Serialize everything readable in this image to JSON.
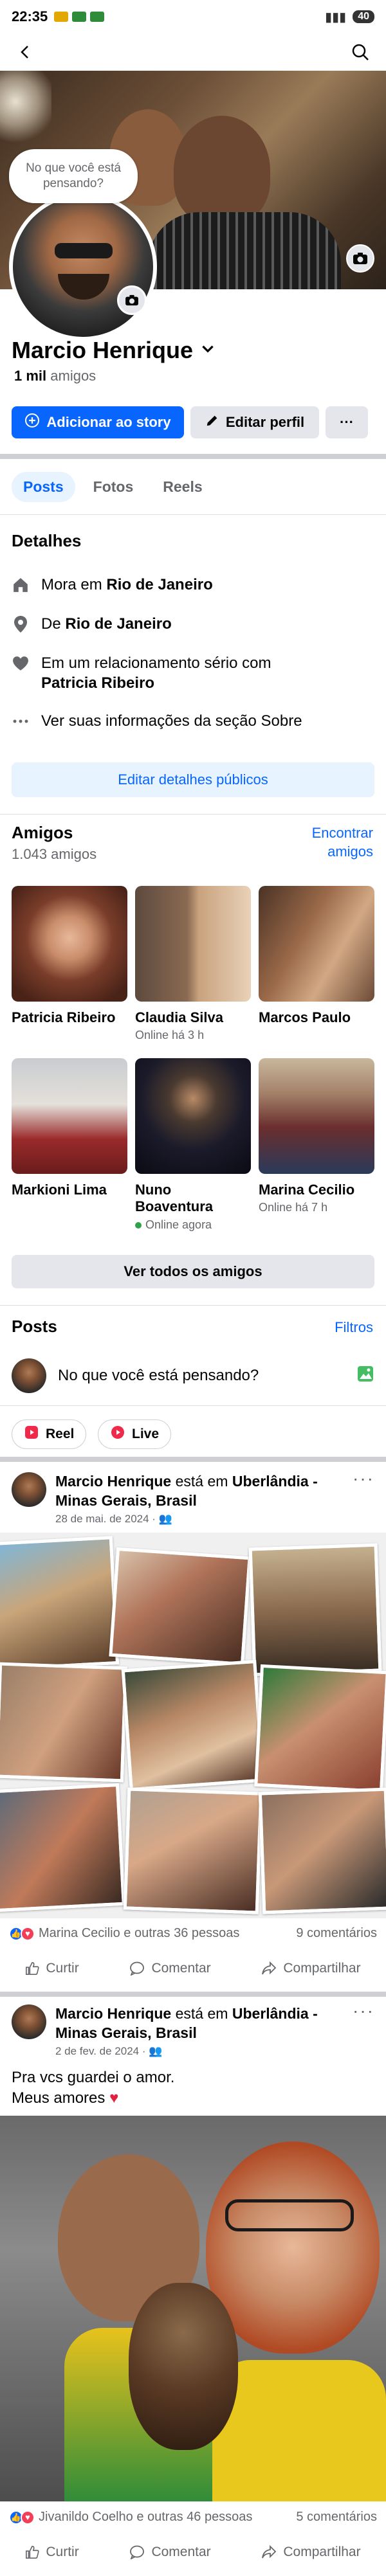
{
  "status_bar": {
    "time": "22:35",
    "battery": "40"
  },
  "cover": {
    "bubble_text": "No que você está pensando?"
  },
  "profile": {
    "name": "Marcio Henrique",
    "friends_count_bold": "1 mil",
    "friends_count_label": " amigos"
  },
  "actions": {
    "add_story": "Adicionar ao story",
    "edit_profile": "Editar perfil",
    "more": "···"
  },
  "tabs": [
    "Posts",
    "Fotos",
    "Reels"
  ],
  "details": {
    "title": "Detalhes",
    "lives_prefix": "Mora em ",
    "lives_city": "Rio de Janeiro",
    "from_prefix": "De ",
    "from_city": "Rio de Janeiro",
    "relationship_prefix": "Em um relacionamento sério com",
    "relationship_partner": "Patricia Ribeiro",
    "about": "Ver suas informações da seção Sobre",
    "edit_button": "Editar detalhes públicos"
  },
  "friends": {
    "title": "Amigos",
    "count": "1.043 amigos",
    "find_line1": "Encontrar",
    "find_line2": "amigos",
    "see_all": "Ver todos os amigos",
    "list": [
      {
        "name": "Patricia Ribeiro",
        "sub": ""
      },
      {
        "name": "Claudia Silva",
        "sub": "Online há 3 h"
      },
      {
        "name": "Marcos Paulo",
        "sub": ""
      },
      {
        "name": "Markioni Lima",
        "sub": ""
      },
      {
        "name_line1": "Nuno",
        "name_line2": "Boaventura",
        "sub": "Online agora"
      },
      {
        "name": "Marina Cecilio",
        "sub": "Online há 7 h"
      }
    ]
  },
  "posts_section": {
    "title": "Posts",
    "filters": "Filtros",
    "composer_placeholder": "No que você está pensando?",
    "reel": "Reel",
    "live": "Live"
  },
  "posts": [
    {
      "author": "Marcio Henrique",
      "is_at": " está em ",
      "place": "Uberlândia - Minas Gerais, Brasil",
      "date": "28 de mai. de 2024 · ",
      "reactions_text": "Marina Cecilio e outras 36 pessoas",
      "comments": "9 comentários"
    },
    {
      "author": "Marcio Henrique",
      "is_at": " está em ",
      "place": "Uberlândia - Minas Gerais, Brasil",
      "date": "2 de fev. de 2024 · ",
      "text_line1": "Pra vcs guardei o amor.",
      "text_line2": "Meus amores ",
      "reactions_text": "Jivanildo Coelho e outras 46 pessoas",
      "comments": "5 comentários"
    }
  ],
  "post_actions": {
    "like": "Curtir",
    "comment": "Comentar",
    "share": "Compartilhar"
  },
  "colors": {
    "accent": "#0866ff",
    "accent_light": "#e7f3ff",
    "grey_button": "#e4e6eb",
    "secondary_text": "#65676b",
    "online": "#31a24c"
  },
  "icons": [
    "back-arrow-icon",
    "search-icon",
    "camera-icon",
    "chevron-down-icon",
    "add-story-icon",
    "pencil-icon",
    "home-icon",
    "location-pin-icon",
    "heart-icon",
    "ellipsis-icon",
    "gallery-icon",
    "reel-icon",
    "live-icon",
    "like-icon",
    "love-icon",
    "comment-icon",
    "share-icon",
    "friends-audience-icon",
    "heart-emoji-icon"
  ]
}
